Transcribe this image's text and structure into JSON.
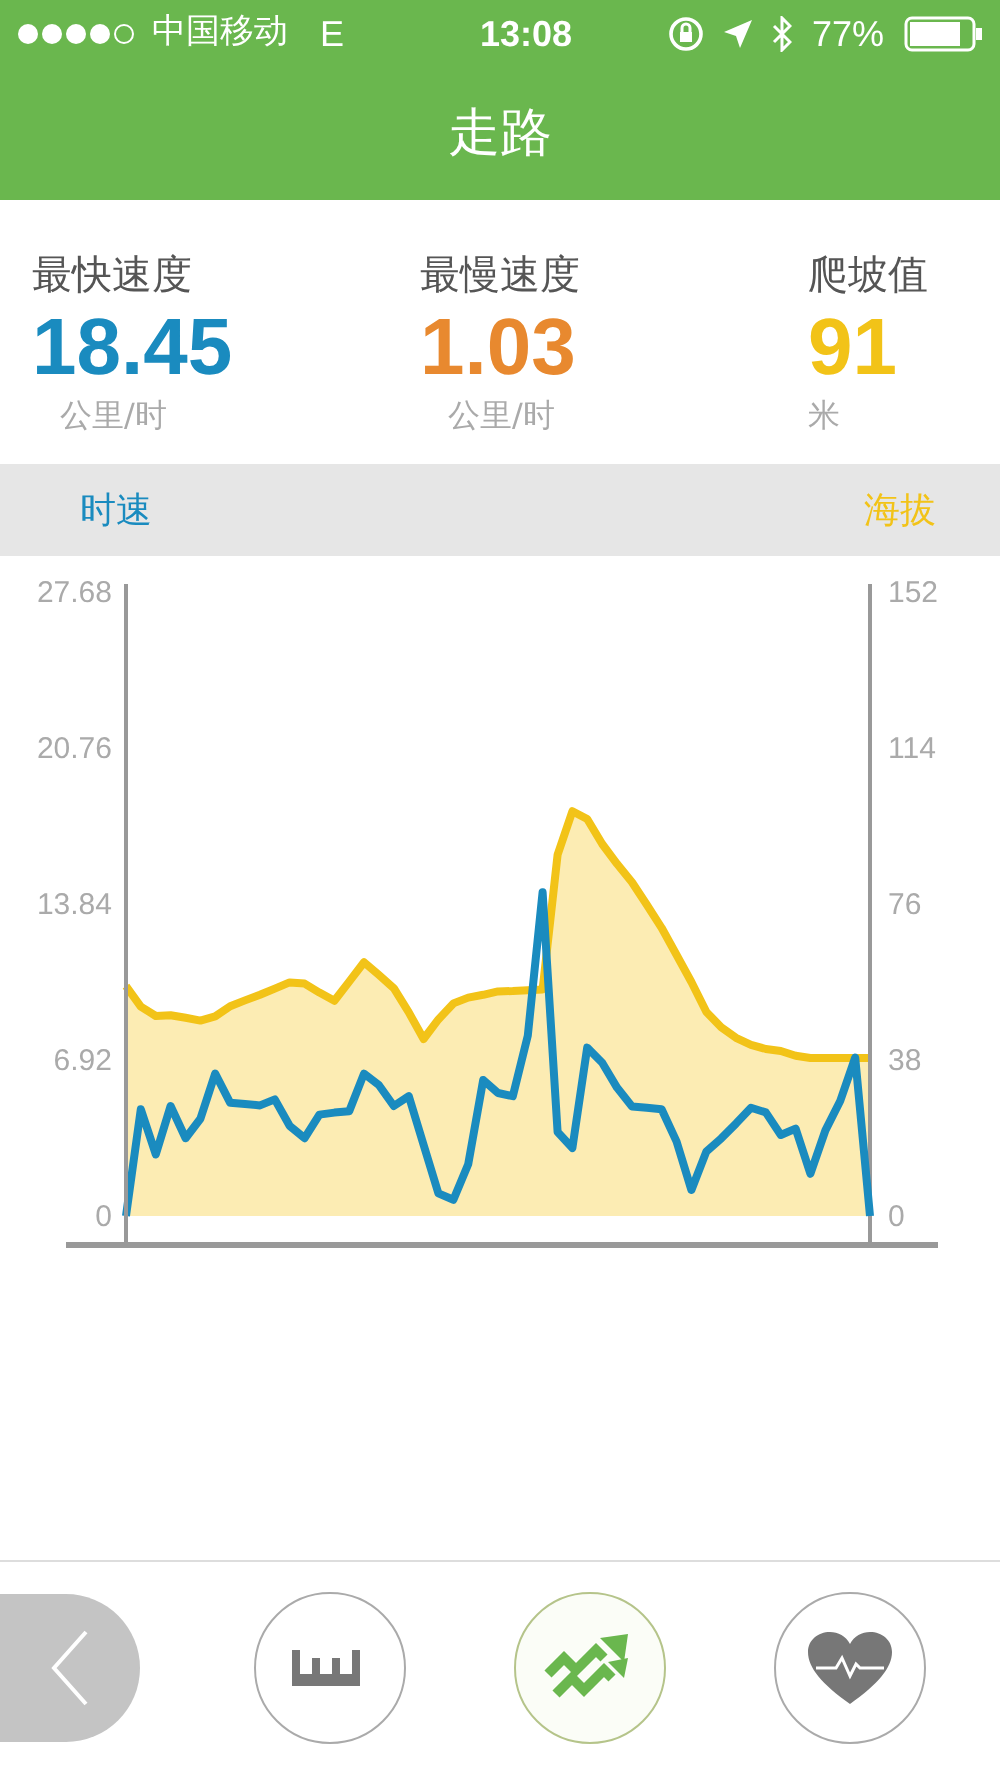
{
  "status_bar": {
    "carrier": "中国移动",
    "network": "E",
    "time": "13:08",
    "battery": "77%"
  },
  "header": {
    "title": "走路"
  },
  "stats": [
    {
      "label": "最快速度",
      "value": "18.45",
      "unit": "公里/时",
      "color": "#1a8bbf"
    },
    {
      "label": "最慢速度",
      "value": "1.03",
      "unit": "公里/时",
      "color": "#e8892f"
    },
    {
      "label": "爬坡值",
      "value": "91",
      "unit": "米",
      "color": "#f2c318"
    }
  ],
  "speed_chart": {
    "chart_data": {
      "type": "line",
      "categories": [
        null,
        null,
        null,
        null,
        null,
        null,
        null,
        null,
        null,
        null,
        null,
        null,
        null,
        null,
        null,
        null,
        null,
        null,
        null,
        null,
        null,
        null,
        null,
        null,
        null,
        null,
        null,
        null,
        null,
        null,
        null,
        null,
        null,
        null,
        null,
        null,
        null,
        null,
        null,
        null,
        null,
        null,
        null,
        null,
        null,
        null,
        null,
        null,
        null,
        null,
        null
      ],
      "ylim": [
        0,
        27.68
      ],
      "yticks": [
        0,
        6.92,
        13.84,
        20.76,
        27.68
      ],
      "series": [
        {
          "name": "时速",
          "color": "#1a8bbf",
          "values": [
            0,
            4.74,
            2.73,
            4.88,
            3.45,
            4.31,
            6.32,
            5.02,
            4.97,
            4.91,
            5.17,
            4.0,
            3.45,
            4.5,
            4.59,
            4.65,
            6.32,
            5.8,
            4.88,
            5.31,
            3.16,
            1.0,
            0.72,
            2.3,
            6.03,
            5.46,
            5.31,
            8.0,
            14.36,
            3.73,
            3.02,
            7.47,
            6.8,
            5.7,
            4.86,
            4.8,
            4.74,
            3.3,
            1.15,
            2.87,
            3.44,
            4.1,
            4.8,
            4.6,
            3.59,
            3.88,
            1.87,
            3.8,
            5.1,
            7.03,
            0
          ]
        }
      ]
    }
  },
  "elevation_chart": {
    "chart_data": {
      "type": "area",
      "categories": [
        null,
        null,
        null,
        null,
        null,
        null,
        null,
        null,
        null,
        null,
        null,
        null,
        null,
        null,
        null,
        null,
        null,
        null,
        null,
        null,
        null,
        null,
        null,
        null,
        null,
        null,
        null,
        null,
        null,
        null,
        null,
        null,
        null,
        null,
        null,
        null,
        null,
        null,
        null,
        null,
        null,
        null,
        null,
        null,
        null,
        null,
        null,
        null,
        null,
        null,
        null
      ],
      "ylim": [
        0,
        152
      ],
      "yticks": [
        0,
        38,
        76,
        114,
        152
      ],
      "series": [
        {
          "name": "海拔",
          "color": "#f2c318",
          "values": [
            56,
            51,
            48.7,
            48.9,
            48.3,
            47.6,
            48.6,
            51.1,
            52.5,
            53.9,
            55.4,
            56.9,
            56.6,
            54.4,
            52.4,
            57.1,
            61.8,
            58.7,
            55.5,
            49.6,
            43.1,
            47.9,
            51.8,
            53.2,
            53.9,
            54.7,
            54.8,
            55,
            55.2,
            88,
            98.6,
            96.7,
            90.6,
            85.8,
            81.3,
            75.8,
            70.2,
            63.6,
            57,
            49.7,
            46,
            43.4,
            41.7,
            40.7,
            40.2,
            39,
            38.5,
            38.5,
            38.5,
            38.5,
            38.5
          ]
        }
      ]
    }
  },
  "bottom_nav": {
    "tabs": [
      {
        "kind": "ruler",
        "selected": false
      },
      {
        "kind": "trend",
        "selected": true
      },
      {
        "kind": "heart",
        "selected": false
      }
    ]
  }
}
